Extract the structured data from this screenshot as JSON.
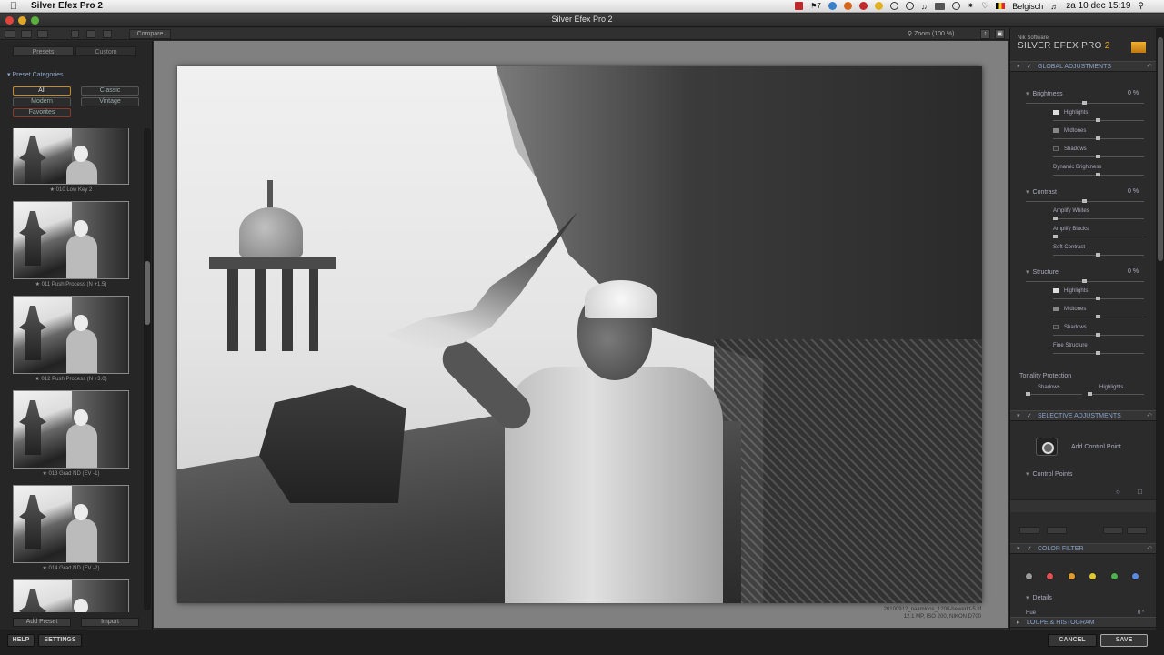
{
  "menubar": {
    "app_name": "Silver Efex Pro 2",
    "badge_count": "7",
    "keyboard_layout": "Belgisch",
    "datetime": "za 10 dec  15:19"
  },
  "window": {
    "title": "Silver Efex Pro 2"
  },
  "toolbar": {
    "compare_label": "Compare",
    "zoom_label": "Zoom (100 %)"
  },
  "left_panel": {
    "tabs": [
      "Presets",
      "Custom"
    ],
    "categories_header": "Preset Categories",
    "categories": [
      "All",
      "Classic",
      "Modern",
      "Vintage",
      "Favorites"
    ],
    "presets": [
      "★ 010 Low Key 2",
      "★ 011 Push Process (N +1.5)",
      "★ 012 Push Process (N +3.0)",
      "★ 013 Grad ND (EV -1)",
      "★ 014 Grad ND (EV -2)"
    ],
    "add_preset_label": "Add Preset",
    "import_label": "Import"
  },
  "photo": {
    "filename": "20100912_naamloos_1200-bewerkt-5.tif",
    "info": "12.1 MP, ISO 200, NIKON D700"
  },
  "right_panel": {
    "brand_small": "Nik Software",
    "brand_name": "SILVER EFEX PRO",
    "brand_version": "2",
    "global_adjustments": "GLOBAL ADJUSTMENTS",
    "brightness": {
      "label": "Brightness",
      "value": "0 %"
    },
    "brightness_subs": [
      "Highlights",
      "Midtones",
      "Shadows",
      "Dynamic Brightness"
    ],
    "contrast": {
      "label": "Contrast",
      "value": "0 %"
    },
    "contrast_subs": [
      "Amplify Whites",
      "Amplify Blacks",
      "Soft Contrast"
    ],
    "structure": {
      "label": "Structure",
      "value": "0 %"
    },
    "structure_subs": [
      "Highlights",
      "Midtones",
      "Shadows",
      "Fine Structure"
    ],
    "tonality_protection": "Tonality Protection",
    "tonality_shadows": "Shadows",
    "tonality_highlights": "Highlights",
    "selective_adjustments": "SELECTIVE ADJUSTMENTS",
    "add_control_point": "Add Control Point",
    "control_points": "Control Points",
    "color_filter": "COLOR FILTER",
    "filter_colors": [
      "#9a9a9a",
      "#e05050",
      "#e09a30",
      "#e0c830",
      "#50b050",
      "#5a8ae0"
    ],
    "details": "Details",
    "hue": "Hue",
    "hue_value": "0 °",
    "loupe_histogram": "LOUPE & HISTOGRAM"
  },
  "bottom": {
    "help": "HELP",
    "settings": "SETTINGS",
    "cancel": "CANCEL",
    "save": "SAVE"
  }
}
